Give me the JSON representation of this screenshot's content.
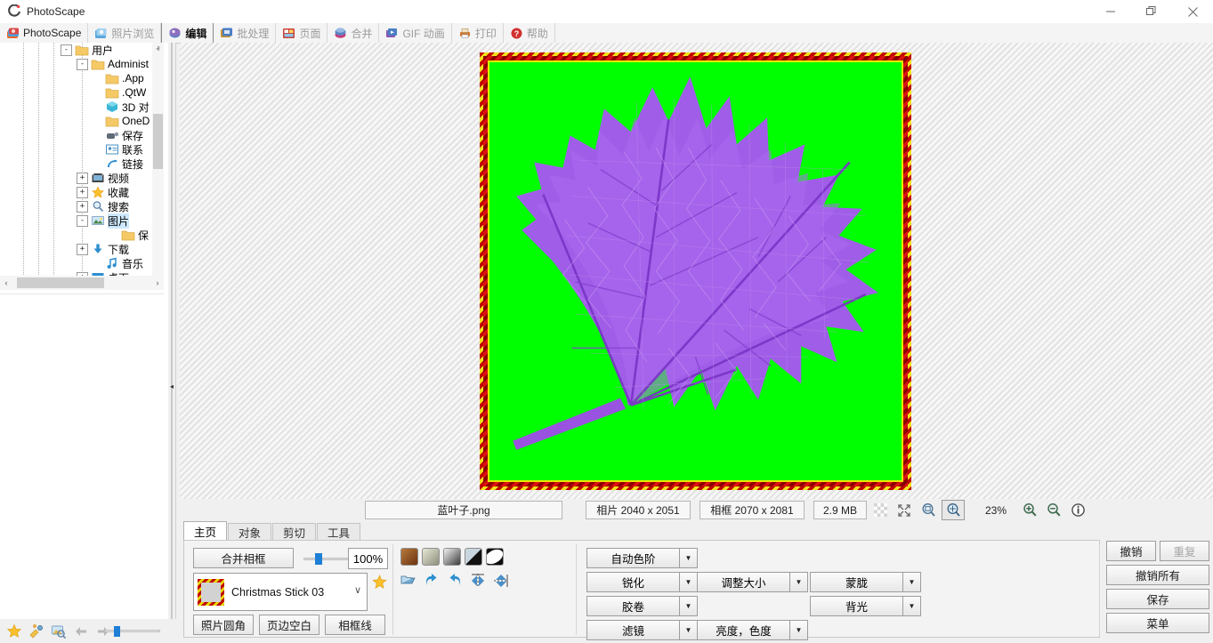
{
  "window": {
    "title": "PhotoScape",
    "app_icon": "photoscape-logo-icon",
    "minimize": "—",
    "maximize": "❐",
    "close": "✕"
  },
  "main_tabs": [
    {
      "label": "PhotoScape",
      "icon": "photoscape-icon",
      "active": false,
      "home": true
    },
    {
      "label": "照片浏览",
      "icon": "photo-browse-icon",
      "active": false
    },
    {
      "label": "编辑",
      "icon": "editor-icon",
      "active": true
    },
    {
      "label": "批处理",
      "icon": "batch-editor-icon",
      "active": false
    },
    {
      "label": "页面",
      "icon": "page-icon",
      "active": false
    },
    {
      "label": "合并",
      "icon": "combine-icon",
      "active": false
    },
    {
      "label": "GIF 动画",
      "icon": "gif-animation-icon",
      "active": false
    },
    {
      "label": "打印",
      "icon": "print-icon",
      "active": false
    },
    {
      "label": "帮助",
      "icon": "help-icon",
      "active": false
    }
  ],
  "tree": {
    "items": [
      {
        "label": "用户",
        "icon": "folder-icon",
        "indent": 0,
        "expander": "-",
        "selected": false
      },
      {
        "label": "Administ",
        "icon": "folder-icon",
        "indent": 1,
        "expander": "-",
        "selected": false
      },
      {
        "label": ".App",
        "icon": "folder-icon",
        "indent": 2,
        "expander": "",
        "selected": false
      },
      {
        "label": ".QtW",
        "icon": "folder-icon",
        "indent": 2,
        "expander": "",
        "selected": false
      },
      {
        "label": "3D 对",
        "icon": "3d-objects-icon",
        "indent": 2,
        "expander": "",
        "selected": false
      },
      {
        "label": "OneD",
        "icon": "folder-icon",
        "indent": 2,
        "expander": "",
        "selected": false
      },
      {
        "label": "保存",
        "icon": "saved-games-icon",
        "indent": 2,
        "expander": "",
        "selected": false
      },
      {
        "label": "联系",
        "icon": "contacts-icon",
        "indent": 2,
        "expander": "",
        "selected": false
      },
      {
        "label": "链接",
        "icon": "links-icon",
        "indent": 2,
        "expander": "",
        "selected": false
      },
      {
        "label": "视频",
        "icon": "videos-icon",
        "indent": 2,
        "expander": "+",
        "selected": false
      },
      {
        "label": "收藏",
        "icon": "favorites-star-icon",
        "indent": 2,
        "expander": "+",
        "selected": false
      },
      {
        "label": "搜索",
        "icon": "search-icon",
        "indent": 2,
        "expander": "+",
        "selected": false
      },
      {
        "label": "图片",
        "icon": "pictures-icon",
        "indent": 2,
        "expander": "-",
        "selected": true
      },
      {
        "label": "保",
        "icon": "folder-icon",
        "indent": 3,
        "expander": "",
        "selected": false
      },
      {
        "label": "下载",
        "icon": "downloads-icon",
        "indent": 2,
        "expander": "+",
        "selected": false
      },
      {
        "label": "音乐",
        "icon": "music-icon",
        "indent": 2,
        "expander": "",
        "selected": false
      },
      {
        "label": "桌面",
        "icon": "desktop-icon",
        "indent": 2,
        "expander": "+",
        "selected": false
      }
    ],
    "scroll_up": "ⱏ",
    "scroll_down": "ⱟ",
    "scroll_left": "‹",
    "scroll_right": "›"
  },
  "splitter": {
    "collapse_arrow": "◂"
  },
  "canvas": {
    "photo_background_color": "#00ff00",
    "frame_name": "Christmas Stick 03",
    "subject": "purple-maple-leaf"
  },
  "infobar": {
    "filename": "蓝叶子.png",
    "photo_label": "相片 2040 x 2051",
    "frame_label": "相框 2070 x 2081",
    "filesize": "2.9 MB",
    "zoom": "23%",
    "icons": [
      {
        "name": "checker-transparency-icon"
      },
      {
        "name": "fullscreen-expand-icon"
      },
      {
        "name": "zoom-fit-icon"
      },
      {
        "name": "zoom-actual-icon"
      },
      {
        "name": "zoom-in-icon"
      },
      {
        "name": "zoom-out-icon"
      },
      {
        "name": "info-icon"
      }
    ]
  },
  "editor": {
    "subtabs": [
      {
        "label": "主页",
        "active": true
      },
      {
        "label": "对象",
        "active": false
      },
      {
        "label": "剪切",
        "active": false
      },
      {
        "label": "工具",
        "active": false
      }
    ],
    "merge_frame_button": "合并相框",
    "opacity_value": "100%",
    "frame_select_value": "Christmas Stick 03",
    "frame_chevron": "∨",
    "favorite_star_icon": "star-icon",
    "frame_row_buttons": [
      "照片圆角",
      "页边空白",
      "相框线"
    ],
    "swatches": [
      {
        "name": "swatch-brown"
      },
      {
        "name": "swatch-khaki"
      },
      {
        "name": "swatch-gray"
      },
      {
        "name": "swatch-diagonal"
      },
      {
        "name": "swatch-blackwhite"
      }
    ],
    "tool_icons": [
      {
        "name": "open-file-icon"
      },
      {
        "name": "undo-arrow-icon"
      },
      {
        "name": "redo-arrow-icon"
      },
      {
        "name": "flip-horizontal-icon"
      },
      {
        "name": "flip-vertical-icon"
      }
    ],
    "dropdowns_col1": [
      {
        "label": "自动色阶",
        "arrow": "▼"
      },
      {
        "label": "锐化",
        "arrow": "▼"
      },
      {
        "label": "胶卷",
        "arrow": "▼"
      },
      {
        "label": "滤镜",
        "arrow": "▼"
      }
    ],
    "dropdowns_col2": [
      {
        "label": "调整大小",
        "arrow": "▼"
      },
      {
        "label": "亮度，色度",
        "arrow": "▼"
      },
      {
        "label": "蒙胧",
        "arrow": "▼"
      },
      {
        "label": "背光",
        "arrow": "▼"
      }
    ],
    "right_buttons": {
      "undo": "撤销",
      "redo": "重复",
      "undo_all": "撤销所有",
      "save": "保存",
      "menu": "菜单"
    }
  },
  "statusbar": {
    "icons": [
      {
        "name": "star-icon"
      },
      {
        "name": "edit-photos-icon"
      },
      {
        "name": "preview-icon"
      },
      {
        "name": "back-arrow-icon"
      },
      {
        "name": "forward-arrow-icon"
      }
    ]
  }
}
